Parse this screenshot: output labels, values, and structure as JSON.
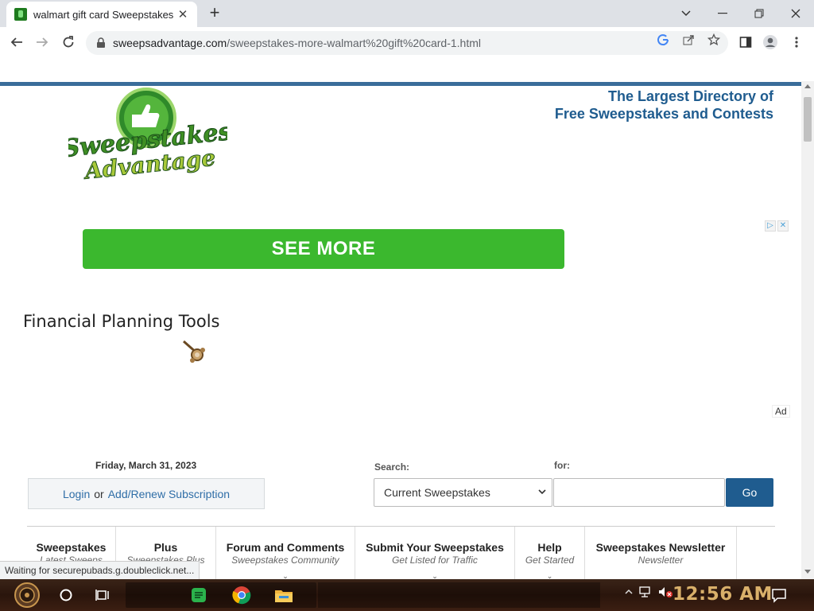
{
  "browser": {
    "tab_title": "walmart gift card Sweepstakes",
    "url_host": "sweepsadvantage.com",
    "url_path": "/sweepstakes-more-walmart%20gift%20card-1.html",
    "status_text": "Waiting for securepubads.g.doubleclick.net..."
  },
  "header": {
    "logo_line1": "Sweepstakes",
    "logo_line2": "Advantage",
    "tagline_line1": "The Largest Directory of",
    "tagline_line2": "Free Sweepstakes and Contests"
  },
  "ad": {
    "button_label": "SEE MORE",
    "title": "Financial Planning Tools",
    "ad_label": "Ad"
  },
  "account": {
    "date": "Friday, March 31, 2023",
    "login_link": "Login",
    "or_text": "or",
    "subscribe_link": "Add/Renew Subscription"
  },
  "search": {
    "search_label": "Search:",
    "for_label": "for:",
    "selected_option": "Current Sweepstakes",
    "go_label": "Go"
  },
  "nav": [
    {
      "title": "Sweepstakes",
      "subtitle": "Latest Sweeps"
    },
    {
      "title": "Plus",
      "subtitle": "Sweepstakes Plus"
    },
    {
      "title": "Forum and Comments",
      "subtitle": "Sweepstakes Community"
    },
    {
      "title": "Submit Your Sweepstakes",
      "subtitle": "Get Listed for Traffic"
    },
    {
      "title": "Help",
      "subtitle": "Get Started"
    },
    {
      "title": "Sweepstakes Newsletter",
      "subtitle": "Newsletter"
    }
  ],
  "taskbar": {
    "clock": "12:56 AM"
  },
  "colors": {
    "brand_blue": "#1f5c8f",
    "ad_green": "#3bb82e",
    "clock_gold": "#d9b06a"
  }
}
